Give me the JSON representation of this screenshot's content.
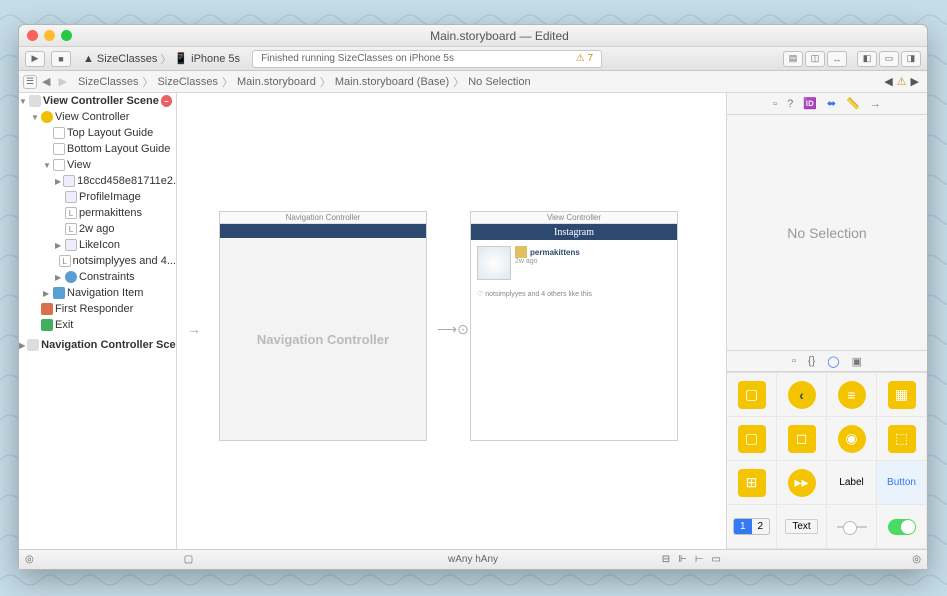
{
  "window_title": "Main.storyboard — Edited",
  "toolbar": {
    "scheme_project": "SizeClasses",
    "scheme_device": "iPhone 5s",
    "activity_text": "Finished running SizeClasses on iPhone 5s",
    "warnings": "⚠ 7"
  },
  "breadcrumb": {
    "items": [
      "SizeClasses",
      "SizeClasses",
      "Main.storyboard",
      "Main.storyboard (Base)",
      "No Selection"
    ]
  },
  "outline": {
    "scene1": "View Controller Scene",
    "vc": "View Controller",
    "top_guide": "Top Layout Guide",
    "bottom_guide": "Bottom Layout Guide",
    "view": "View",
    "img_id": "18ccd458e81711e2...",
    "profile": "ProfileImage",
    "user": "permakittens",
    "time": "2w ago",
    "like": "LikeIcon",
    "likers": "notsimplyyes and 4...",
    "constraints": "Constraints",
    "navitem": "Navigation Item",
    "responder": "First Responder",
    "exit": "Exit",
    "scene2": "Navigation Controller Scene"
  },
  "canvas": {
    "nc_title": "Navigation Controller",
    "nc_body": "Navigation Controller",
    "vc_title": "View Controller",
    "nav_brand": "Instagram",
    "post_user": "permakittens",
    "post_time": "2w ago",
    "likes_text": "♡  notsimplyyes and 4 others like this"
  },
  "inspector": {
    "no_selection": "No Selection",
    "label_text": "Label",
    "button_text": "Button",
    "text_label": "Text",
    "seg_1": "1",
    "seg_2": "2"
  },
  "bottom": {
    "size_w": "wAny",
    "size_h": "hAny"
  }
}
